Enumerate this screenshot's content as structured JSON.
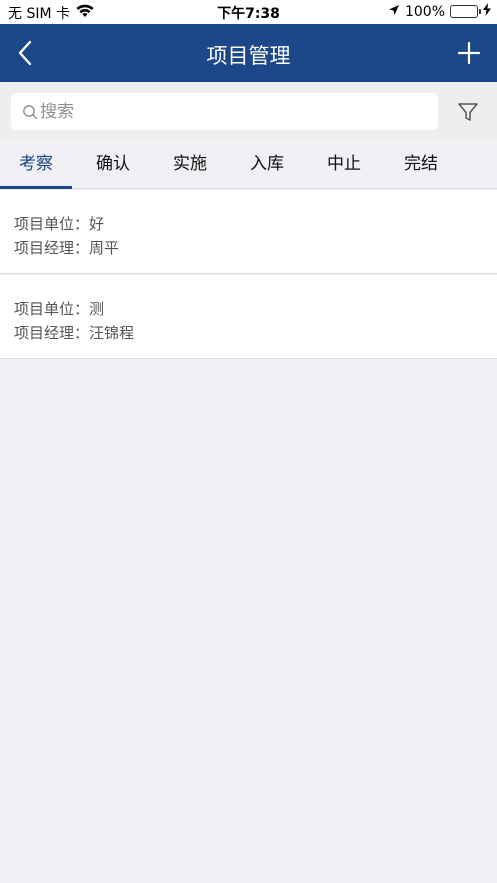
{
  "status_bar": {
    "carrier": "无 SIM 卡",
    "time": "下午7:38",
    "battery": "100%",
    "battery_level": 1.0
  },
  "nav": {
    "title": "项目管理",
    "back_icon": "chevron-left-icon",
    "add_icon": "plus-icon"
  },
  "search": {
    "placeholder": "搜索",
    "value": ""
  },
  "tabs": [
    {
      "label": "考察",
      "active": true
    },
    {
      "label": "确认",
      "active": false
    },
    {
      "label": "实施",
      "active": false
    },
    {
      "label": "入库",
      "active": false
    },
    {
      "label": "中止",
      "active": false
    },
    {
      "label": "完结",
      "active": false
    }
  ],
  "projects": [
    {
      "unit_label": "项目单位：",
      "unit": "好",
      "manager_label": "项目经理：",
      "manager": "周平"
    },
    {
      "unit_label": "项目单位：",
      "unit": "测",
      "manager_label": "项目经理：",
      "manager": "汪锦程"
    }
  ],
  "colors": {
    "primary": "#1c4789",
    "background": "#efeff4",
    "battery": "#34c759"
  }
}
